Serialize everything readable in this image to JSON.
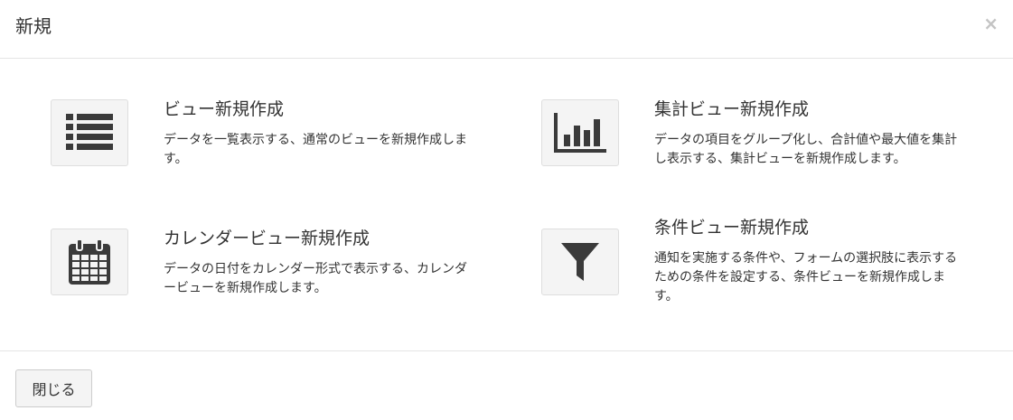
{
  "modal": {
    "title": "新規",
    "close_symbol": "×",
    "options": [
      {
        "title": "ビュー新規作成",
        "description": "データを一覧表示する、通常のビューを新規作成します。",
        "icon": "list-icon"
      },
      {
        "title": "集計ビュー新規作成",
        "description": "データの項目をグループ化し、合計値や最大値を集計し表示する、集計ビューを新規作成します。",
        "icon": "bar-chart-icon"
      },
      {
        "title": "カレンダービュー新規作成",
        "description": "データの日付をカレンダー形式で表示する、カレンダービューを新規作成します。",
        "icon": "calendar-icon"
      },
      {
        "title": "条件ビュー新規作成",
        "description": "通知を実施する条件や、フォームの選択肢に表示するための条件を設定する、条件ビューを新規作成します。",
        "icon": "filter-icon"
      }
    ],
    "footer": {
      "close_label": "閉じる"
    },
    "colors": {
      "icon": "#3a3a3a",
      "icon_box_bg": "#f4f4f4",
      "close_x": "#c4c4c4"
    }
  }
}
